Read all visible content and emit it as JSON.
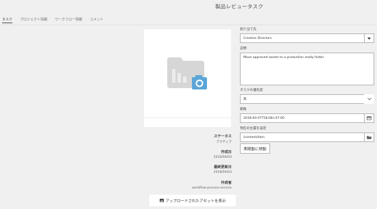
{
  "header": {
    "title": "製品レビュータスク"
  },
  "tabs": [
    {
      "label": "タスク",
      "active": true
    },
    {
      "label": "プロジェクト情報",
      "active": false
    },
    {
      "label": "ワークフロー情報",
      "active": false
    },
    {
      "label": "コメント",
      "active": false
    }
  ],
  "meta": {
    "status_label": "ステータス",
    "status_value": "アクティブ",
    "created_label": "作成日",
    "created_value": "2018/04/03",
    "updated_label": "最終更新日",
    "updated_value": "2018/04/03",
    "author_label": "作成者",
    "author_value": "workflow-process-service"
  },
  "upload_button": {
    "label": "アップロードされたアセットを表示"
  },
  "form": {
    "assignee_label": "割り当て先",
    "assignee_value": "Creative Directors",
    "description_label": "説明",
    "description_value": "Move approved assets to a production ready folder.",
    "priority_label": "タスクの優先度",
    "priority_value": "高",
    "due_label": "期限",
    "due_value": "2018-04-07T18:08+07:00",
    "location_label": "現在の位置を設定",
    "location_value": "/content/dam",
    "move_button": "実稼動に移動"
  },
  "colors": {
    "background": "#f0f0f0",
    "card": "#ffffff",
    "folder_gray": "#d6d6d6",
    "camera_blue": "#5ba5d8"
  },
  "icons": {
    "dropdown": "chevron-down-icon",
    "calendar": "calendar-icon",
    "folder_picker": "folder-icon",
    "upload_button": "image-icon",
    "thumbnail": "folder-camera-placeholder-icon"
  }
}
